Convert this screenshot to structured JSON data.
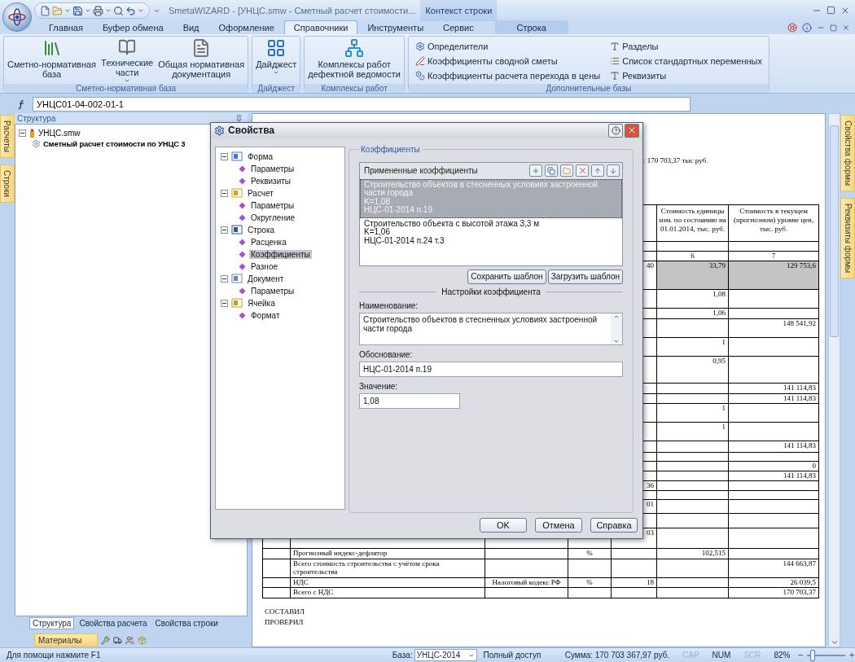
{
  "window": {
    "title": "SmetaWIZARD - [УНЦС.smw - Сметный расчет стоимости...",
    "context_tab": "Контекст строки"
  },
  "ribbon_tabs": [
    {
      "label": "Главная",
      "selected": false,
      "kind": "main"
    },
    {
      "label": "Буфер обмена",
      "selected": false,
      "kind": "main"
    },
    {
      "label": "Вид",
      "selected": false,
      "kind": "main"
    },
    {
      "label": "Оформление",
      "selected": false,
      "kind": "main"
    },
    {
      "label": "Справочники",
      "selected": true,
      "kind": "main"
    },
    {
      "label": "Инструменты",
      "selected": false,
      "kind": "main"
    },
    {
      "label": "Сервис",
      "selected": false,
      "kind": "main"
    },
    {
      "label": "Строка",
      "selected": false,
      "kind": "context"
    }
  ],
  "ribbon_groups": [
    {
      "title": "Сметно-нормативная база",
      "kind": "large",
      "buttons": [
        {
          "label": "Сметно-нормативная\nбаза",
          "dropdown": false
        },
        {
          "label": "Технические\nчасти",
          "dropdown": true
        },
        {
          "label": "Общая нормативная\nдокументация",
          "dropdown": false
        }
      ]
    },
    {
      "title": "Дайджест",
      "kind": "large",
      "buttons": [
        {
          "label": "Дайджест",
          "dropdown": true
        }
      ]
    },
    {
      "title": "Комплексы работ",
      "kind": "large",
      "buttons": [
        {
          "label": "Комплексы работ\nдефектной ведомости",
          "dropdown": false
        }
      ]
    },
    {
      "title": "Дополнительные базы",
      "kind": "small",
      "columns": [
        [
          {
            "label": "Определители"
          },
          {
            "label": "Коэффициенты сводной сметы"
          },
          {
            "label": "Коэффициенты расчета перехода в цены"
          }
        ],
        [
          {
            "label": "Разделы"
          },
          {
            "label": "Список стандартных переменных"
          },
          {
            "label": "Реквизиты"
          }
        ]
      ]
    }
  ],
  "formula_bar": {
    "value": "УНЦС01-04-002-01-1"
  },
  "left_strip": [
    "Расчеты",
    "Строки"
  ],
  "structure": {
    "title": "Структура",
    "tree": [
      {
        "label": "УНЦС.smw",
        "kind": "file",
        "expanded": true,
        "children": [
          {
            "label": "Сметный расчет стоимости по УНЦС 3",
            "kind": "estimate"
          }
        ]
      }
    ]
  },
  "bottom_tabs": [
    {
      "label": "Структура",
      "selected": true
    },
    {
      "label": "Свойства расчета",
      "selected": false
    },
    {
      "label": "Свойства строки",
      "selected": false
    }
  ],
  "materials_bar": {
    "label": "Материалы"
  },
  "right_strip": [
    "Свойства формы",
    "Реквизиты формы"
  ],
  "document": {
    "total": ": 170 703,37 тыс руб.",
    "header": {
      "6": "Стоимость единицы изм. по состоянию на 01.01.2014, тыс. руб.",
      "7": "Стоимость в текущем (прогнозном) уровне цен, тыс. руб."
    },
    "rows": [
      {
        "kind": "blank",
        "highlighted": false
      },
      {
        "kind": "numbers",
        "highlighted": false,
        "cells": {
          "6": "6",
          "7": "7"
        }
      },
      {
        "kind": "data",
        "highlighted": true,
        "cells": {
          "5": "40",
          "6": "33,79",
          "7": "129 753,6"
        }
      },
      {
        "kind": "data",
        "highlighted": false,
        "cells": {
          "6": "1,08"
        }
      },
      {
        "kind": "data",
        "highlighted": false,
        "cells": {
          "6": "1,06"
        }
      },
      {
        "kind": "data",
        "highlighted": false,
        "cells": {
          "7": "148 541,92"
        }
      },
      {
        "kind": "data",
        "highlighted": false,
        "cells": {
          "6": "1"
        }
      },
      {
        "kind": "data",
        "highlighted": false,
        "cells": {
          "6": "0,95"
        }
      },
      {
        "kind": "data",
        "highlighted": false,
        "cells": {
          "7": "141 114,83"
        }
      },
      {
        "kind": "data",
        "highlighted": false,
        "cells": {
          "7": "141 114,83"
        }
      },
      {
        "kind": "data",
        "highlighted": false,
        "cells": {
          "6": "1"
        }
      },
      {
        "kind": "data",
        "highlighted": false,
        "cells": {
          "6": "1"
        }
      },
      {
        "kind": "data",
        "highlighted": false,
        "cells": {
          "7": "141 114,83"
        }
      },
      {
        "kind": "blank",
        "highlighted": false
      },
      {
        "kind": "data",
        "highlighted": false,
        "cells": {
          "7": "0"
        }
      },
      {
        "kind": "data",
        "highlighted": false,
        "cells": {
          "7": "141 114,83"
        }
      },
      {
        "kind": "data",
        "highlighted": false,
        "cells": {
          "5": "36"
        }
      },
      {
        "kind": "blank",
        "highlighted": false
      },
      {
        "kind": "data",
        "highlighted": false,
        "cells": {
          "5": "01"
        }
      },
      {
        "kind": "blank",
        "highlighted": false
      },
      {
        "kind": "data",
        "highlighted": false,
        "cells": {
          "5": "03"
        }
      },
      {
        "kind": "data",
        "highlighted": false,
        "cells": {
          "2": "Прогнозный индекс-дефлятор",
          "4": "%",
          "6": "102,515"
        }
      },
      {
        "kind": "data",
        "highlighted": false,
        "cells": {
          "2": "Всего стоимость строительства с учётом срока строительства",
          "7": "144 663,87"
        }
      },
      {
        "kind": "data",
        "highlighted": false,
        "cells": {
          "2": "НДС",
          "3": "Налоговый кодекс РФ",
          "4": "%",
          "5": "18",
          "7": "26 039,5"
        }
      },
      {
        "kind": "data",
        "highlighted": false,
        "cells": {
          "2": "Всего с НДС",
          "7": "170 703,37"
        }
      }
    ],
    "signatures": [
      "СОСТАВИЛ",
      "ПРОВЕРИЛ"
    ]
  },
  "dialog": {
    "title": "Свойства",
    "tree": [
      {
        "label": "Форма",
        "kind": "form",
        "expanded": true,
        "children": [
          {
            "label": "Параметры",
            "selected": false
          },
          {
            "label": "Реквизиты",
            "selected": false
          }
        ]
      },
      {
        "label": "Расчет",
        "kind": "calc",
        "expanded": true,
        "children": [
          {
            "label": "Параметры",
            "selected": false
          },
          {
            "label": "Округление",
            "selected": false
          }
        ]
      },
      {
        "label": "Строка",
        "kind": "row",
        "expanded": true,
        "children": [
          {
            "label": "Расценка",
            "selected": false
          },
          {
            "label": "Коэффициенты",
            "selected": true
          },
          {
            "label": "Разное",
            "selected": false
          }
        ]
      },
      {
        "label": "Документ",
        "kind": "doc",
        "expanded": true,
        "children": [
          {
            "label": "Параметры",
            "selected": false
          }
        ]
      },
      {
        "label": "Ячейка",
        "kind": "cell",
        "expanded": true,
        "children": [
          {
            "label": "Формат",
            "selected": false
          }
        ]
      }
    ],
    "section_title": "Коэффициенты",
    "applied": {
      "title": "Примененные коэффициенты",
      "items": [
        {
          "lines": [
            "Строительство объектов в стесненных условиях застроенной части города",
            "K=1,08",
            "НЦС-01-2014 п.19"
          ],
          "selected": true
        },
        {
          "lines": [
            "Строительство объекта с высотой этажа 3,3 м",
            "K=1,06",
            "НЦС-01-2014 п.24 т.3"
          ],
          "selected": false
        }
      ]
    },
    "template_buttons": [
      "Сохранить шаблон",
      "Загрузить шаблон"
    ],
    "settings_title": "Настройки коэффициента",
    "fields": [
      {
        "label": "Наименование:",
        "value": "Строительство объектов в стесненных условиях застроенной части города",
        "kind": "multiline"
      },
      {
        "label": "Обоснование:",
        "value": "НЦС-01-2014 п.19",
        "kind": "wide"
      },
      {
        "label": "Значение:",
        "value": "1,08",
        "kind": "short"
      }
    ],
    "buttons": [
      "OK",
      "Отмена",
      "Справка"
    ]
  },
  "status_bar": {
    "hint": "Для помощи нажмите F1",
    "base_label": "База:",
    "base_value": "УНЦС-2014",
    "access": "Полный доступ",
    "sum": "Сумма: 170 703 367,97 руб.",
    "indicators": [
      {
        "label": "CAP",
        "on": false
      },
      {
        "label": "NUM",
        "on": true
      },
      {
        "label": "SCR",
        "on": false
      }
    ],
    "zoom": "82%",
    "zoom_slider": {
      "level": 0.15
    }
  }
}
